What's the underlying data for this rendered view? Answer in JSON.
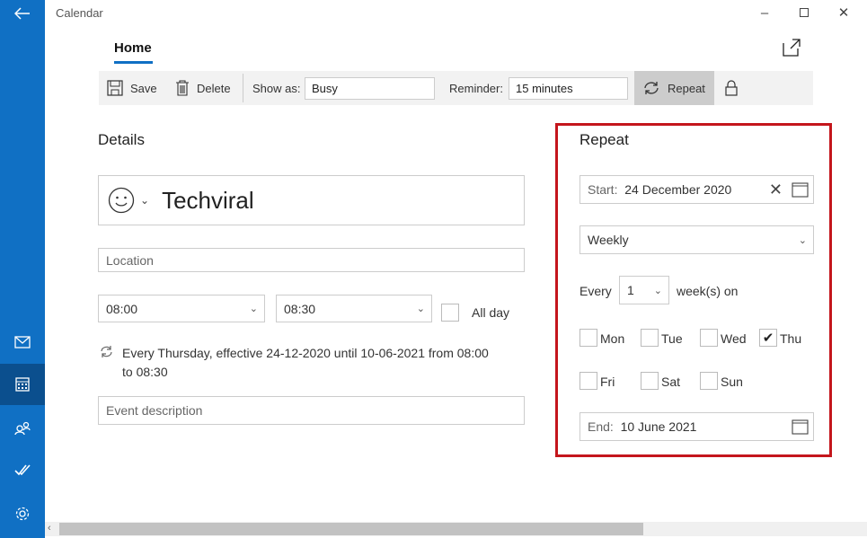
{
  "window": {
    "title": "Calendar",
    "minimize_icon": "minimize-icon",
    "maximize_icon": "maximize-icon",
    "close_icon": "close-icon"
  },
  "sidebar": {
    "items": [
      {
        "name": "mail",
        "icon": "mail-icon",
        "selected": false
      },
      {
        "name": "calendar",
        "icon": "calendar-icon",
        "selected": true
      },
      {
        "name": "people",
        "icon": "people-icon",
        "selected": false
      },
      {
        "name": "todo",
        "icon": "todo-icon",
        "selected": false
      },
      {
        "name": "settings",
        "icon": "gear-icon",
        "selected": false
      }
    ]
  },
  "tabs": [
    {
      "label": "Home",
      "active": true
    }
  ],
  "toolbar": {
    "save": "Save",
    "delete": "Delete",
    "show_as_label": "Show as:",
    "show_as_value": "Busy",
    "reminder_label": "Reminder:",
    "reminder_value": "15 minutes",
    "repeat": "Repeat"
  },
  "details": {
    "heading": "Details",
    "title_value": "Techviral",
    "location_placeholder": "Location",
    "start_time": "08:00",
    "end_time": "08:30",
    "all_day_label": "All day",
    "all_day": false,
    "recurrence_summary_line1": "Every Thursday, effective 24-12-2020 until 10-06-2021 from 08:00",
    "recurrence_summary_line2": "to 08:30",
    "description_placeholder": "Event description"
  },
  "repeat": {
    "heading": "Repeat",
    "start_label": "Start:",
    "start_value": "24 December 2020",
    "frequency": "Weekly",
    "every_label": "Every",
    "every_value": "1",
    "unit_label": "week(s) on",
    "days": [
      {
        "label": "Mon",
        "checked": false
      },
      {
        "label": "Tue",
        "checked": false
      },
      {
        "label": "Wed",
        "checked": false
      },
      {
        "label": "Thu",
        "checked": true
      },
      {
        "label": "Fri",
        "checked": false
      },
      {
        "label": "Sat",
        "checked": false
      },
      {
        "label": "Sun",
        "checked": false
      }
    ],
    "end_label": "End:",
    "end_value": "10 June 2021"
  },
  "colors": {
    "accent": "#1070c4",
    "highlight_border": "#c4161c"
  }
}
